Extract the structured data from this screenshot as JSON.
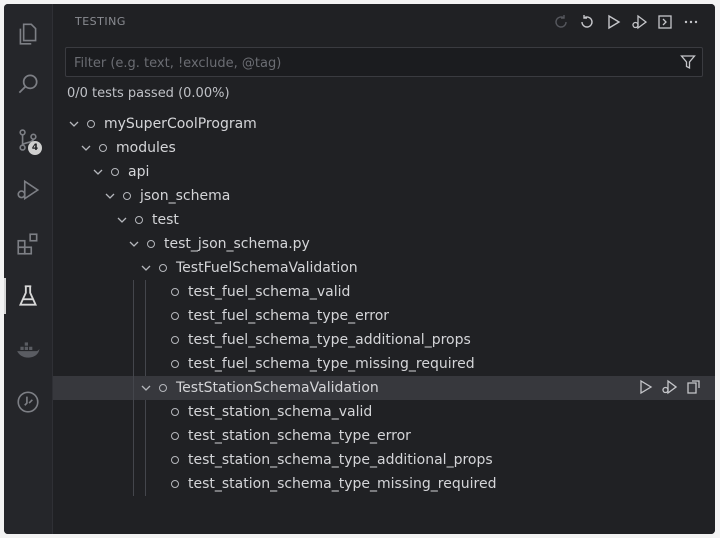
{
  "panel": {
    "title": "TESTING",
    "toolbar": [
      "refresh-disabled-icon",
      "rerun-icon",
      "run-icon",
      "debug-icon",
      "terminal-icon",
      "more-icon"
    ]
  },
  "filter": {
    "placeholder": "Filter (e.g. text, !exclude, @tag)",
    "value": ""
  },
  "summary": "0/0 tests passed (0.00%)",
  "activity": {
    "scm_badge": "4"
  },
  "tree": [
    {
      "label": "mySuperCoolProgram",
      "depth": 0,
      "expanded": true
    },
    {
      "label": "modules",
      "depth": 1,
      "expanded": true
    },
    {
      "label": "api",
      "depth": 2,
      "expanded": true
    },
    {
      "label": "json_schema",
      "depth": 3,
      "expanded": true
    },
    {
      "label": "test",
      "depth": 4,
      "expanded": true
    },
    {
      "label": "test_json_schema.py",
      "depth": 5,
      "expanded": true
    },
    {
      "label": "TestFuelSchemaValidation",
      "depth": 6,
      "expanded": true
    },
    {
      "label": "test_fuel_schema_valid",
      "depth": 7
    },
    {
      "label": "test_fuel_schema_type_error",
      "depth": 7
    },
    {
      "label": "test_fuel_schema_type_additional_props",
      "depth": 7
    },
    {
      "label": "test_fuel_schema_type_missing_required",
      "depth": 7
    },
    {
      "label": "TestStationSchemaValidation",
      "depth": 6,
      "expanded": true,
      "selected": true
    },
    {
      "label": "test_station_schema_valid",
      "depth": 7
    },
    {
      "label": "test_station_schema_type_error",
      "depth": 7
    },
    {
      "label": "test_station_schema_type_additional_props",
      "depth": 7
    },
    {
      "label": "test_station_schema_type_missing_required",
      "depth": 7
    }
  ],
  "colors": {
    "background": "#1e1f22",
    "selection": "#37383d",
    "foreground": "#d4d5d8"
  }
}
